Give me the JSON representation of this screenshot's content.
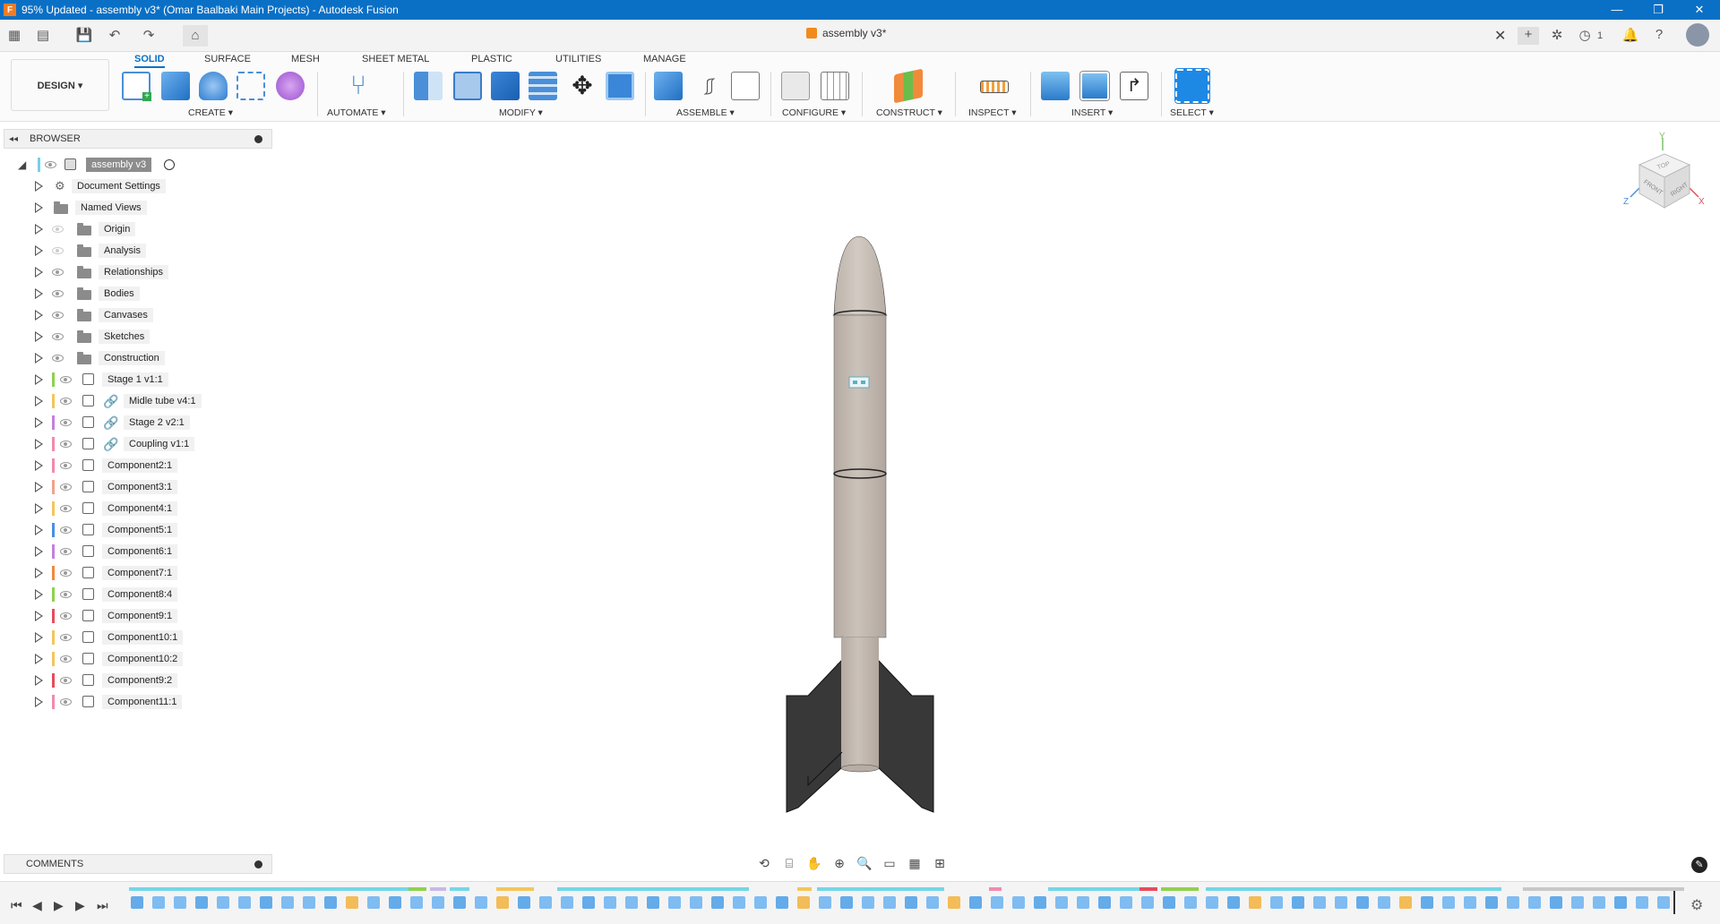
{
  "window": {
    "title": "95% Updated - assembly v3* (Omar Baalbaki Main Projects) - Autodesk Fusion",
    "app_icon_letter": "F",
    "controls": [
      "—",
      "❐",
      "✕"
    ]
  },
  "quick_access": {
    "document_tab": "assembly v3*",
    "jobs_count": "1"
  },
  "ribbon": {
    "workspace": "DESIGN ▾",
    "tabs": [
      "SOLID",
      "SURFACE",
      "MESH",
      "SHEET METAL",
      "PLASTIC",
      "UTILITIES",
      "MANAGE"
    ],
    "active_tab": "SOLID",
    "groups": [
      "CREATE ▾",
      "AUTOMATE ▾",
      "MODIFY ▾",
      "ASSEMBLE ▾",
      "CONFIGURE ▾",
      "CONSTRUCT ▾",
      "INSPECT ▾",
      "INSERT ▾",
      "SELECT ▾"
    ]
  },
  "browser": {
    "header": "BROWSER",
    "root": "assembly v3",
    "items": [
      {
        "label": "Document Settings",
        "kind": "settings",
        "visible": true
      },
      {
        "label": "Named Views",
        "kind": "folder",
        "visible": true
      },
      {
        "label": "Origin",
        "kind": "folder",
        "visible": false
      },
      {
        "label": "Analysis",
        "kind": "folder",
        "visible": false
      },
      {
        "label": "Relationships",
        "kind": "folder",
        "visible": true
      },
      {
        "label": "Bodies",
        "kind": "folder",
        "visible": true
      },
      {
        "label": "Canvases",
        "kind": "folder",
        "visible": true
      },
      {
        "label": "Sketches",
        "kind": "folder",
        "visible": true
      },
      {
        "label": "Construction",
        "kind": "folder",
        "visible": true
      },
      {
        "label": "Stage 1 v1:1",
        "kind": "component",
        "color": "#8fd14f",
        "visible": true
      },
      {
        "label": "Midle tube v4:1",
        "kind": "linked",
        "color": "#f3c65a",
        "visible": true
      },
      {
        "label": "Stage 2 v2:1",
        "kind": "linked",
        "color": "#c57fe0",
        "visible": true
      },
      {
        "label": "Coupling v1:1",
        "kind": "linked",
        "color": "#f28ab0",
        "visible": true
      },
      {
        "label": "Component2:1",
        "kind": "component",
        "color": "#f28ab0",
        "visible": true
      },
      {
        "label": "Component3:1",
        "kind": "component",
        "color": "#f2a38a",
        "visible": true
      },
      {
        "label": "Component4:1",
        "kind": "component",
        "color": "#f3c65a",
        "visible": true
      },
      {
        "label": "Component5:1",
        "kind": "component",
        "color": "#4a90e2",
        "visible": true
      },
      {
        "label": "Component6:1",
        "kind": "component",
        "color": "#c57fe0",
        "visible": true
      },
      {
        "label": "Component7:1",
        "kind": "component",
        "color": "#f28a3c",
        "visible": true
      },
      {
        "label": "Component8:4",
        "kind": "component",
        "color": "#8fd14f",
        "visible": true
      },
      {
        "label": "Component9:1",
        "kind": "component",
        "color": "#e84b5c",
        "visible": true
      },
      {
        "label": "Component10:1",
        "kind": "component",
        "color": "#f3c65a",
        "visible": true
      },
      {
        "label": "Component10:2",
        "kind": "component",
        "color": "#f3c65a",
        "visible": true
      },
      {
        "label": "Component9:2",
        "kind": "component",
        "color": "#e84b5c",
        "visible": true
      },
      {
        "label": "Component11:1",
        "kind": "component",
        "color": "#f28ab0",
        "visible": true
      }
    ]
  },
  "viewcube": {
    "top": "TOP",
    "front": "FRONT",
    "right": "RIGHT",
    "axis_x": "X",
    "axis_y": "Y",
    "axis_z": "Z"
  },
  "comments": {
    "label": "COMMENTS"
  },
  "colors": {
    "accent": "#0a70c6",
    "body": "#c6bdb5",
    "fins": "#3a3a3a"
  }
}
